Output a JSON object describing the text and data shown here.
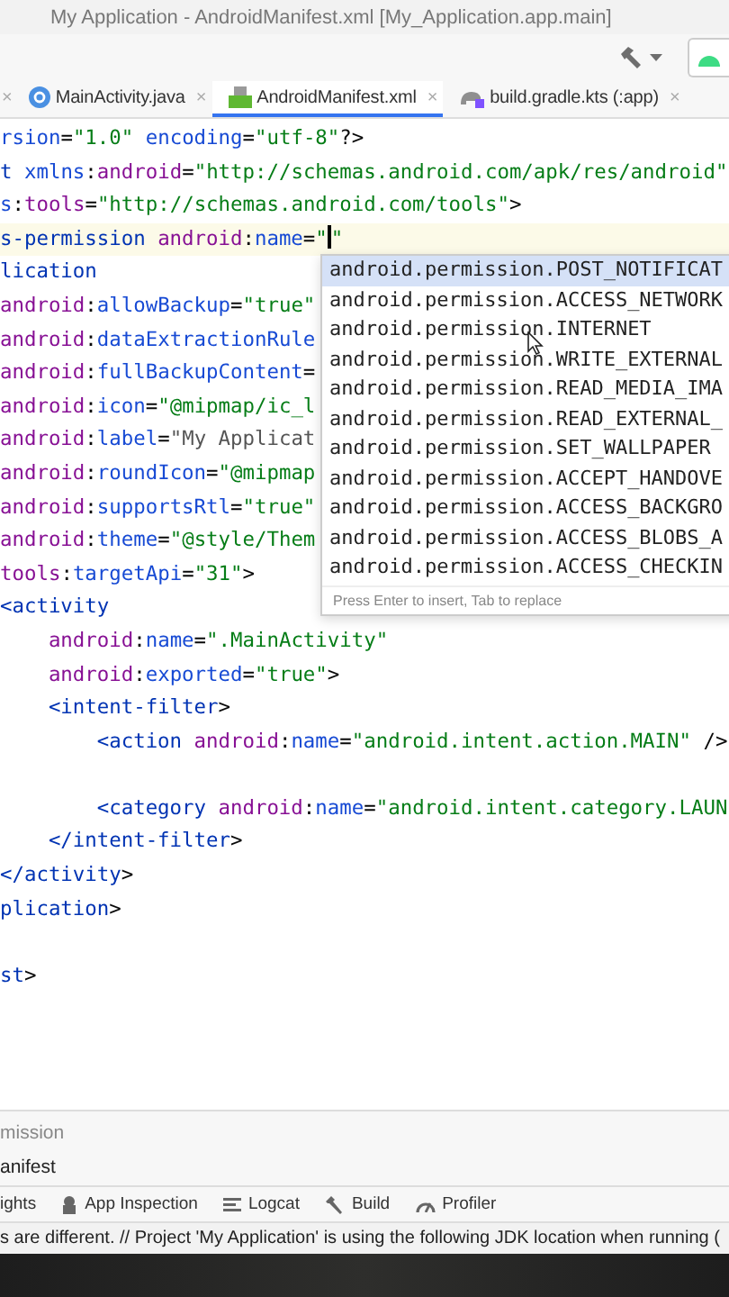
{
  "window": {
    "title": "My Application - AndroidManifest.xml [My_Application.app.main]"
  },
  "tabs": [
    {
      "label": "×",
      "kind": "close",
      "selected": false
    },
    {
      "label": "MainActivity.java",
      "close": "×",
      "kind": "java",
      "selected": false
    },
    {
      "label": "AndroidManifest.xml",
      "close": "×",
      "kind": "manifest",
      "selected": true
    },
    {
      "label": "build.gradle.kts (:app)",
      "close": "×",
      "kind": "gradle",
      "selected": false
    }
  ],
  "editor": {
    "lines": [
      {
        "kind": "code",
        "current": false,
        "segments": [
          {
            "kind": "name",
            "text": "rsion"
          },
          {
            "kind": "punct",
            "text": "="
          },
          {
            "kind": "value",
            "text": "\"1.0\""
          },
          {
            "kind": "name",
            "text": " encoding"
          },
          {
            "kind": "punct",
            "text": "="
          },
          {
            "kind": "value",
            "text": "\"utf-8\""
          },
          {
            "kind": "punct",
            "text": "?>"
          }
        ]
      },
      {
        "kind": "code",
        "current": false,
        "segments": [
          {
            "kind": "tag",
            "text": "t"
          },
          {
            "kind": "name",
            "text": " xmlns"
          },
          {
            "kind": "punct",
            "text": ":"
          },
          {
            "kind": "prefix",
            "text": "android"
          },
          {
            "kind": "punct",
            "text": "="
          },
          {
            "kind": "value",
            "text": "\"http://schemas.android.com/apk/res/android\""
          }
        ]
      },
      {
        "kind": "code",
        "current": false,
        "segments": [
          {
            "kind": "name",
            "text": "s"
          },
          {
            "kind": "punct",
            "text": ":"
          },
          {
            "kind": "prefix",
            "text": "tools"
          },
          {
            "kind": "punct",
            "text": "="
          },
          {
            "kind": "value",
            "text": "\"http://schemas.android.com/tools\""
          },
          {
            "kind": "punct",
            "text": ">"
          }
        ]
      },
      {
        "kind": "code",
        "current": true,
        "segments": [
          {
            "kind": "tag",
            "text": "s-permission"
          },
          {
            "kind": "prefix",
            "text": " android"
          },
          {
            "kind": "punct",
            "text": ":"
          },
          {
            "kind": "name",
            "text": "name"
          },
          {
            "kind": "punct",
            "text": "="
          },
          {
            "kind": "value",
            "text": "\""
          },
          {
            "kind": "caret"
          },
          {
            "kind": "value",
            "text": "\""
          }
        ]
      },
      {
        "kind": "code",
        "current": false,
        "segments": [
          {
            "kind": "tag",
            "text": "lication"
          }
        ]
      },
      {
        "kind": "code",
        "current": false,
        "segments": [
          {
            "kind": "prefix",
            "text": "android"
          },
          {
            "kind": "punct",
            "text": ":"
          },
          {
            "kind": "name",
            "text": "allowBackup"
          },
          {
            "kind": "punct",
            "text": "="
          },
          {
            "kind": "value",
            "text": "\"true\""
          }
        ]
      },
      {
        "kind": "code",
        "current": false,
        "segments": [
          {
            "kind": "prefix",
            "text": "android"
          },
          {
            "kind": "punct",
            "text": ":"
          },
          {
            "kind": "name",
            "text": "dataExtractionRule"
          }
        ]
      },
      {
        "kind": "code",
        "current": false,
        "segments": [
          {
            "kind": "prefix",
            "text": "android"
          },
          {
            "kind": "punct",
            "text": ":"
          },
          {
            "kind": "name",
            "text": "fullBackupContent"
          },
          {
            "kind": "punct",
            "text": "="
          }
        ]
      },
      {
        "kind": "code",
        "current": false,
        "segments": [
          {
            "kind": "prefix",
            "text": "android"
          },
          {
            "kind": "punct",
            "text": ":"
          },
          {
            "kind": "name",
            "text": "icon"
          },
          {
            "kind": "punct",
            "text": "="
          },
          {
            "kind": "value",
            "text": "\"@mipmap/ic_l"
          }
        ]
      },
      {
        "kind": "code",
        "current": false,
        "segments": [
          {
            "kind": "prefix",
            "text": "android"
          },
          {
            "kind": "punct",
            "text": ":"
          },
          {
            "kind": "name",
            "text": "label"
          },
          {
            "kind": "punct",
            "text": "="
          },
          {
            "kind": "plainvalue",
            "text": "\"My Applicat"
          }
        ]
      },
      {
        "kind": "code",
        "current": false,
        "segments": [
          {
            "kind": "prefix",
            "text": "android"
          },
          {
            "kind": "punct",
            "text": ":"
          },
          {
            "kind": "name",
            "text": "roundIcon"
          },
          {
            "kind": "punct",
            "text": "="
          },
          {
            "kind": "value",
            "text": "\"@mipmap"
          }
        ]
      },
      {
        "kind": "code",
        "current": false,
        "segments": [
          {
            "kind": "prefix",
            "text": "android"
          },
          {
            "kind": "punct",
            "text": ":"
          },
          {
            "kind": "name",
            "text": "supportsRtl"
          },
          {
            "kind": "punct",
            "text": "="
          },
          {
            "kind": "value",
            "text": "\"true\""
          }
        ]
      },
      {
        "kind": "code",
        "current": false,
        "segments": [
          {
            "kind": "prefix",
            "text": "android"
          },
          {
            "kind": "punct",
            "text": ":"
          },
          {
            "kind": "name",
            "text": "theme"
          },
          {
            "kind": "punct",
            "text": "="
          },
          {
            "kind": "value",
            "text": "\"@style/Them"
          }
        ]
      },
      {
        "kind": "code",
        "current": false,
        "segments": [
          {
            "kind": "prefix",
            "text": "tools"
          },
          {
            "kind": "punct",
            "text": ":"
          },
          {
            "kind": "name",
            "text": "targetApi"
          },
          {
            "kind": "punct",
            "text": "="
          },
          {
            "kind": "value",
            "text": "\"31\""
          },
          {
            "kind": "punct",
            "text": ">"
          }
        ]
      },
      {
        "kind": "code",
        "current": false,
        "segments": [
          {
            "kind": "tag",
            "text": "<activity"
          }
        ]
      },
      {
        "kind": "code",
        "current": false,
        "segments": [
          {
            "kind": "prefix",
            "text": "    android"
          },
          {
            "kind": "punct",
            "text": ":"
          },
          {
            "kind": "name",
            "text": "name"
          },
          {
            "kind": "punct",
            "text": "="
          },
          {
            "kind": "value",
            "text": "\".MainActivity\""
          }
        ]
      },
      {
        "kind": "code",
        "current": false,
        "segments": [
          {
            "kind": "prefix",
            "text": "    android"
          },
          {
            "kind": "punct",
            "text": ":"
          },
          {
            "kind": "name",
            "text": "exported"
          },
          {
            "kind": "punct",
            "text": "="
          },
          {
            "kind": "value",
            "text": "\"true\""
          },
          {
            "kind": "punct",
            "text": ">"
          }
        ]
      },
      {
        "kind": "code",
        "current": false,
        "segments": [
          {
            "kind": "tag",
            "text": "    <intent-filter"
          },
          {
            "kind": "punct",
            "text": ">"
          }
        ]
      },
      {
        "kind": "code",
        "current": false,
        "segments": [
          {
            "kind": "tag",
            "text": "        <action"
          },
          {
            "kind": "prefix",
            "text": " android"
          },
          {
            "kind": "punct",
            "text": ":"
          },
          {
            "kind": "name",
            "text": "name"
          },
          {
            "kind": "punct",
            "text": "="
          },
          {
            "kind": "value",
            "text": "\"android.intent.action.MAIN\""
          },
          {
            "kind": "punct",
            "text": " />"
          }
        ]
      },
      {
        "kind": "blank",
        "current": false
      },
      {
        "kind": "code",
        "current": false,
        "segments": [
          {
            "kind": "tag",
            "text": "        <category"
          },
          {
            "kind": "prefix",
            "text": " android"
          },
          {
            "kind": "punct",
            "text": ":"
          },
          {
            "kind": "name",
            "text": "name"
          },
          {
            "kind": "punct",
            "text": "="
          },
          {
            "kind": "value",
            "text": "\"android.intent.category.LAUN"
          }
        ]
      },
      {
        "kind": "code",
        "current": false,
        "segments": [
          {
            "kind": "tag",
            "text": "    </intent-filter"
          },
          {
            "kind": "punct",
            "text": ">"
          }
        ]
      },
      {
        "kind": "code",
        "current": false,
        "segments": [
          {
            "kind": "tag",
            "text": "</activity"
          },
          {
            "kind": "punct",
            "text": ">"
          }
        ]
      },
      {
        "kind": "code",
        "current": false,
        "segments": [
          {
            "kind": "tag",
            "text": "plication"
          },
          {
            "kind": "punct",
            "text": ">"
          }
        ]
      },
      {
        "kind": "blank",
        "current": false
      },
      {
        "kind": "code",
        "current": false,
        "segments": [
          {
            "kind": "tag",
            "text": "st"
          },
          {
            "kind": "punct",
            "text": ">"
          }
        ]
      }
    ]
  },
  "completion": {
    "items": [
      {
        "label": "android.permission.POST_NOTIFICAT",
        "selected": true
      },
      {
        "label": "android.permission.ACCESS_NETWORK",
        "selected": false
      },
      {
        "label": "android.permission.INTERNET",
        "selected": false
      },
      {
        "label": "android.permission.WRITE_EXTERNAL",
        "selected": false
      },
      {
        "label": "android.permission.READ_MEDIA_IMA",
        "selected": false
      },
      {
        "label": "android.permission.READ_EXTERNAL_",
        "selected": false
      },
      {
        "label": "android.permission.SET_WALLPAPER",
        "selected": false
      },
      {
        "label": "android.permission.ACCEPT_HANDOVE",
        "selected": false
      },
      {
        "label": "android.permission.ACCESS_BACKGRO",
        "selected": false
      },
      {
        "label": "android.permission.ACCESS_BLOBS_A",
        "selected": false
      },
      {
        "label": "android.permission.ACCESS_CHECKIN",
        "selected": false
      }
    ],
    "hint": "Press Enter to insert, Tab to replace"
  },
  "breadcrumbs": [
    "mission",
    "anifest"
  ],
  "tool_windows": [
    {
      "label": "ights",
      "kind": "none"
    },
    {
      "label": "App Inspection",
      "kind": "inspection"
    },
    {
      "label": "Logcat",
      "kind": "logcat"
    },
    {
      "label": "Build",
      "kind": "build"
    },
    {
      "label": "Profiler",
      "kind": "profiler"
    }
  ],
  "status_bar": "s are different. // Project 'My Application' is using the following JDK location when running ("
}
